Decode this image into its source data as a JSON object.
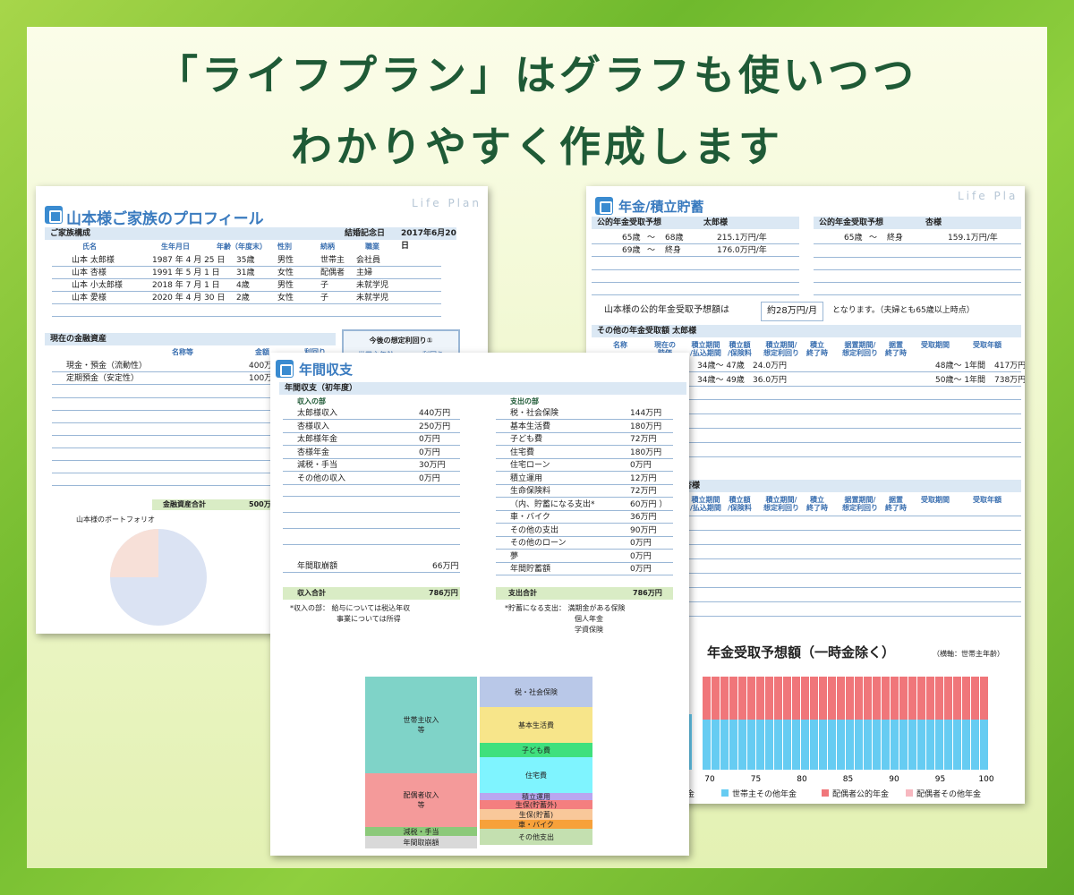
{
  "headline": {
    "line1": "「ライフプラン」はグラフも使いつつ",
    "line2": "わかりやすく作成します"
  },
  "profile": {
    "title": "山本様ご家族のプロフィール",
    "watermark": "Life Plan",
    "family_label": "ご家族構成",
    "anniv_label": "結婚記念日",
    "anniv_value": "2017年6月20日",
    "headers": [
      "氏名",
      "生年月日",
      "年齢（年度末）",
      "性別",
      "続柄",
      "職業"
    ],
    "members": [
      {
        "name": "山本 太郎様",
        "birth": "1987 年 4 月 25 日",
        "age": "35歳",
        "sex": "男性",
        "rel": "世帯主",
        "job": "会社員"
      },
      {
        "name": "山本 杏様",
        "birth": "1991 年 5 月 1 日",
        "age": "31歳",
        "sex": "女性",
        "rel": "配偶者",
        "job": "主婦"
      },
      {
        "name": "山本 小太郎様",
        "birth": "2018 年 7 月 1 日",
        "age": "4歳",
        "sex": "男性",
        "rel": "子",
        "job": "未就学児"
      },
      {
        "name": "山本 愛様",
        "birth": "2020 年 4 月 30 日",
        "age": "2歳",
        "sex": "女性",
        "rel": "子",
        "job": "未就学児"
      }
    ],
    "assets_label": "現在の金融資産",
    "assets_col1": "名称等",
    "assets_col2": "金額",
    "assets_col3": "利回り",
    "assets": [
      {
        "name": "現金・預金（流動性）",
        "amount": "400万"
      },
      {
        "name": "定期預金（安定性）",
        "amount": "100万"
      }
    ],
    "assets_total_label": "金融資産合計",
    "assets_total": "500万",
    "rate_label": "今後の想定利回り①",
    "rate_sub": "世帯主年齢",
    "rate_sub2": "利回り",
    "portfolio_label": "山本様のポートフォリオ",
    "colors": {
      "pie_main": "#dbe3f3",
      "pie_slice": "#f7e0d8"
    }
  },
  "income": {
    "title": "年間収支",
    "subtitle": "年間収支（初年度）",
    "income_label": "収入の部",
    "expense_label": "支出の部",
    "income_items": [
      {
        "name": "太郎様収入",
        "value": "440万円"
      },
      {
        "name": "杏様収入",
        "value": "250万円"
      },
      {
        "name": "太郎様年金",
        "value": "0万円"
      },
      {
        "name": "杏様年金",
        "value": "0万円"
      },
      {
        "name": "減税・手当",
        "value": "30万円"
      },
      {
        "name": "その他の収入",
        "value": "0万円"
      }
    ],
    "withdraw_name": "年間取崩額",
    "withdraw_value": "66万円",
    "income_total_label": "収入合計",
    "income_total": "786万円",
    "expense_items": [
      {
        "name": "税・社会保険",
        "value": "144万円"
      },
      {
        "name": "基本生活費",
        "value": "180万円"
      },
      {
        "name": "子ども費",
        "value": "72万円"
      },
      {
        "name": "住宅費",
        "value": "180万円"
      },
      {
        "name": "住宅ローン",
        "value": "0万円"
      },
      {
        "name": "積立運用",
        "value": "12万円"
      },
      {
        "name": "生命保険料",
        "value": "72万円"
      },
      {
        "name": "（内、貯蓄になる支出*",
        "value": "60万円 ）"
      },
      {
        "name": "車・バイク",
        "value": "36万円"
      },
      {
        "name": "その他の支出",
        "value": "90万円"
      },
      {
        "name": "その他のローン",
        "value": "0万円"
      },
      {
        "name": "夢",
        "value": "0万円"
      },
      {
        "name": "年間貯蓄額",
        "value": "0万円"
      }
    ],
    "expense_total_label": "支出合計",
    "expense_total": "786万円",
    "note_income_1": "*収入の部： 給与については税込年収",
    "note_income_2": "事業については所得",
    "note_expense_1": "*貯蓄になる支出： 満期金がある保険",
    "note_expense_2": "個人年金",
    "note_expense_3": "学資保険",
    "chart_left": [
      {
        "label": "世帯主収入\n等",
        "color": "#7fd3c8"
      },
      {
        "label": "配偶者収入\n等",
        "color": "#f49a9a"
      },
      {
        "label": "減税・手当",
        "color": "#8cc97a"
      },
      {
        "label": "年間取崩額",
        "color": "#d9d9d9"
      }
    ],
    "chart_right": [
      {
        "label": "税・社会保険",
        "color": "#b9c8e8"
      },
      {
        "label": "基本生活費",
        "color": "#f7e58a"
      },
      {
        "label": "子ども費",
        "color": "#3fe07d"
      },
      {
        "label": "住宅費",
        "color": "#7ff4ff"
      },
      {
        "label": "積立運用",
        "color": "#b9a6f0"
      },
      {
        "label": "生保(貯蓄外)",
        "color": "#f47f7f"
      },
      {
        "label": "生保(貯蓄)",
        "color": "#f9c89a"
      },
      {
        "label": "車・バイク",
        "color": "#f7a13a"
      },
      {
        "label": "その他支出",
        "color": "#c4e0b0"
      }
    ]
  },
  "pension": {
    "title": "年金/積立貯蓄",
    "watermark": "Life Pla",
    "left_label": "公的年金受取予想",
    "left_person": "太郎様",
    "right_label": "公的年金受取予想",
    "right_person": "杏様",
    "left_rows": [
      {
        "from": "65歳",
        "sep": "～",
        "to": "68歳",
        "value": "215.1万円/年"
      },
      {
        "from": "69歳",
        "sep": "～",
        "to": "終身",
        "value": "176.0万円/年"
      }
    ],
    "right_rows": [
      {
        "from": "65歳",
        "sep": "～",
        "to": "終身",
        "value": "159.1万円/年"
      }
    ],
    "summary_pre": "山本様の公的年金受取予想額は",
    "summary_value": "約28万円/月",
    "summary_post": "となります。（夫婦とも65歳以上時点）",
    "other_label": "その他の年金受取額 太郎様",
    "other_label2": "杏様",
    "cols": [
      "名称",
      "現在の\n時価",
      "積立期間\n/払込期間",
      "積立額\n/保険料",
      "積立期間/\n想定利回り",
      "積立\n終了時",
      "据置期間/\n想定利回り",
      "据置\n終了時",
      "受取期間",
      "受取年額"
    ],
    "other_rows": [
      {
        "period": "34歳～ 47歳",
        "amount": "24.0万円",
        "recv": "48歳～ 1年間",
        "annual": "417万円"
      },
      {
        "period": "34歳～ 49歳",
        "amount": "36.0万円",
        "recv": "50歳～ 1年間",
        "annual": "738万円"
      }
    ]
  },
  "chart_data": {
    "type": "bar",
    "title": "年金受取予想額（一時金除く）",
    "subtitle": "（横軸：世帯主年齢）",
    "categories": [
      "70",
      "75",
      "80",
      "85",
      "90",
      "95",
      "100"
    ],
    "x_ticks": [
      "70",
      "75",
      "80",
      "85",
      "90",
      "95",
      "100"
    ],
    "series": [
      {
        "name": "世帯主その他年金",
        "color": "#66ccf2"
      },
      {
        "name": "配偶者公的年金",
        "color": "#f0767a"
      },
      {
        "name": "配偶者その他年金",
        "color": "#f7b8c0"
      }
    ],
    "legend_fragment": "年金"
  }
}
